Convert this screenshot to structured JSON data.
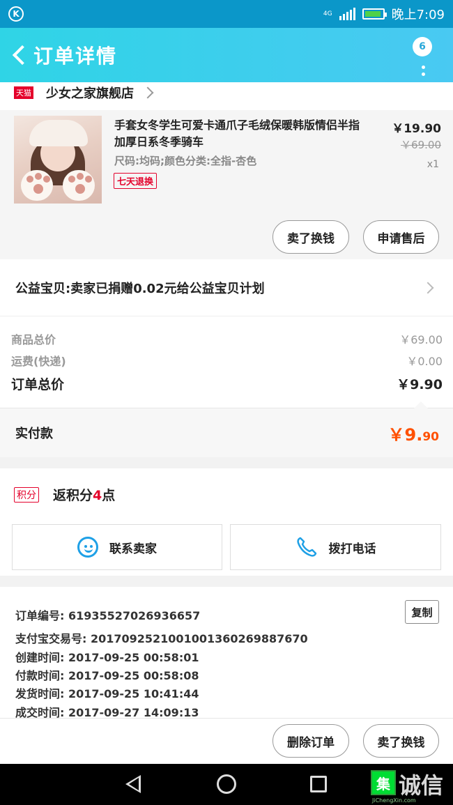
{
  "status_bar": {
    "time": "晚上7:09",
    "network": "4G"
  },
  "header": {
    "title": "订单详情",
    "badge": "6"
  },
  "shop": {
    "badge": "天猫",
    "name": "少女之家旗舰店"
  },
  "product": {
    "title": "手套女冬学生可爱卡通爪子毛绒保暖韩版情侣半指加厚日系冬季骑车",
    "spec": "尺码:均码;颜色分类:全指-杏色",
    "tag": "七天退换",
    "price": "￥19.90",
    "original_price": "￥69.00",
    "quantity": "x1",
    "buttons": {
      "exchange": "卖了换钱",
      "after_sale": "申请售后"
    }
  },
  "charity": {
    "text": "公益宝贝:卖家已捐赠0.02元给公益宝贝计划"
  },
  "totals": {
    "goods_label": "商品总价",
    "goods_value": "￥69.00",
    "shipping_label": "运费(快递)",
    "shipping_value": "￥0.00",
    "order_label": "订单总价",
    "order_value": "￥9.90"
  },
  "paid": {
    "label": "实付款",
    "value_main": "￥9.",
    "value_decimal": "90"
  },
  "points": {
    "tag": "积分",
    "prefix": "返积分",
    "number": "4",
    "suffix": "点"
  },
  "contact": {
    "seller": "联系卖家",
    "call": "拨打电话"
  },
  "order_info": {
    "order_no": "订单编号: 61935527026936657",
    "alipay_no": "支付宝交易号: 2017092521001001360269887670",
    "created": "创建时间: 2017-09-25 00:58:01",
    "paid": "付款时间: 2017-09-25 00:58:08",
    "shipped": "发货时间: 2017-09-25 10:41:44",
    "completed": "成交时间: 2017-09-27 14:09:13",
    "copy": "复制"
  },
  "bottom": {
    "delete": "删除订单",
    "exchange": "卖了换钱"
  },
  "watermark": {
    "box": "集",
    "text": "诚信",
    "url": "JiChengXin.com"
  },
  "colors": {
    "header_start": "#2fd4e6",
    "header_end": "#49c9f2",
    "accent_red": "#e4002b",
    "price_orange": "#ff5000",
    "contact_blue": "#1ea0e6"
  }
}
